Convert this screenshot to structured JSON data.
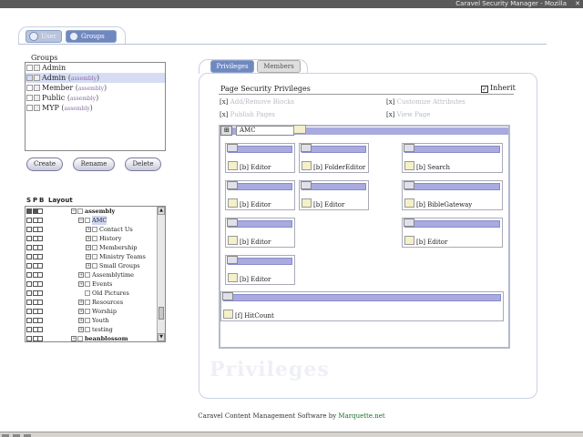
{
  "window": {
    "title": "Caravel Security Manager - Mozilla",
    "close_glyph": "✕"
  },
  "tabs": {
    "user": "User",
    "groups": "Groups"
  },
  "left": {
    "groups_label": "Groups",
    "groups": [
      {
        "name": "Admin",
        "sub": "",
        "selected": false
      },
      {
        "name": "Admin",
        "sub": "assembly",
        "selected": true
      },
      {
        "name": "Member",
        "sub": "assembly",
        "selected": false
      },
      {
        "name": "Public",
        "sub": "assembly",
        "selected": false
      },
      {
        "name": "MYP",
        "sub": "assembly",
        "selected": false
      }
    ],
    "buttons": {
      "create": "Create",
      "rename": "Rename",
      "delete": "Delete"
    },
    "tree_header": {
      "s": "S",
      "p": "P",
      "b": "B",
      "layout": "Layout"
    },
    "tree": [
      {
        "label": "assembly",
        "indent": 0,
        "bold": true,
        "exp": "⊟",
        "selected": false
      },
      {
        "label": "AMC",
        "indent": 1,
        "bold": false,
        "exp": "⊟",
        "selected": true
      },
      {
        "label": "Contact Us",
        "indent": 2,
        "bold": false,
        "exp": "⊞",
        "selected": false
      },
      {
        "label": "History",
        "indent": 2,
        "bold": false,
        "exp": "⊞",
        "selected": false
      },
      {
        "label": "Membership",
        "indent": 2,
        "bold": false,
        "exp": "⊞",
        "selected": false
      },
      {
        "label": "Ministry Teams",
        "indent": 2,
        "bold": false,
        "exp": "⊞",
        "selected": false
      },
      {
        "label": "Small Groups",
        "indent": 2,
        "bold": false,
        "exp": "⊞",
        "selected": false
      },
      {
        "label": "Assemblytime",
        "indent": 1,
        "bold": false,
        "exp": "⊞",
        "selected": false
      },
      {
        "label": "Events",
        "indent": 1,
        "bold": false,
        "exp": "⊞",
        "selected": false
      },
      {
        "label": "Old Pictures",
        "indent": 1,
        "bold": false,
        "exp": "",
        "selected": false
      },
      {
        "label": "Resources",
        "indent": 1,
        "bold": false,
        "exp": "⊞",
        "selected": false
      },
      {
        "label": "Worship",
        "indent": 1,
        "bold": false,
        "exp": "⊞",
        "selected": false
      },
      {
        "label": "Youth",
        "indent": 1,
        "bold": false,
        "exp": "⊞",
        "selected": false
      },
      {
        "label": "testing",
        "indent": 1,
        "bold": false,
        "exp": "⊞",
        "selected": false
      },
      {
        "label": "beanblossom",
        "indent": 0,
        "bold": true,
        "exp": "⊞",
        "selected": false
      }
    ]
  },
  "right": {
    "tabs": {
      "privileges": "Privileges",
      "members": "Members"
    },
    "section_title": "Page Security Privileges",
    "inherit": {
      "label": "Inherit",
      "checked": "✓"
    },
    "permissions": [
      {
        "mark": "[x]",
        "name": "Add/Remove Blocks"
      },
      {
        "mark": "[x]",
        "name": "Customize Attributes"
      },
      {
        "mark": "[x]",
        "name": "Publish Pages"
      },
      {
        "mark": "[x]",
        "name": "View Page"
      }
    ],
    "layout": {
      "grid_glyph": "⊞",
      "page_name": "AMC",
      "modules": [
        "[b] Editor",
        "[b] FolderEditor",
        "[b] Search",
        "[b] Editor",
        "[b] Editor",
        "[b] BibleGateway",
        "[b] Editor",
        "[b] Editor",
        "[b] Editor",
        "[f] HitCount"
      ]
    },
    "watermark": "Privileges"
  },
  "footer": {
    "text": "Caravel Content Management Software by ",
    "link": "Marquette.net"
  }
}
